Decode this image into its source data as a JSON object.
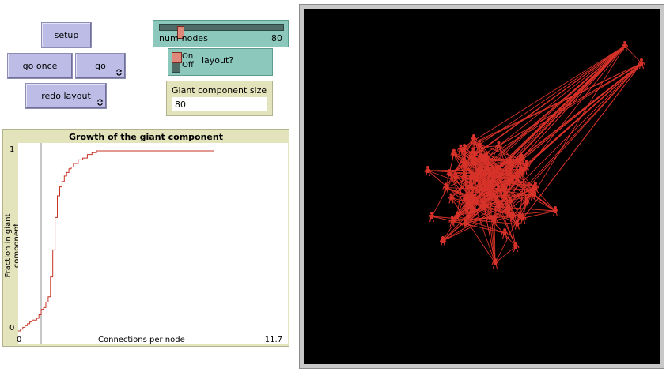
{
  "buttons": {
    "setup": "setup",
    "go_once": "go once",
    "go": "go",
    "redo_layout": "redo layout"
  },
  "slider": {
    "label": "num-nodes",
    "value": "80",
    "fraction": 0.15
  },
  "switch": {
    "on_label": "On",
    "off_label": "Off",
    "name": "layout?",
    "state": "on"
  },
  "monitor": {
    "label": "Giant component size",
    "value": "80"
  },
  "plot": {
    "title": "Growth of the giant component",
    "ylabel": "Fraction in giant component",
    "xlabel": "Connections per node",
    "y_min_label": "0",
    "y_max_label": "1",
    "x_min_label": "0",
    "x_max_label": "11.7"
  },
  "chart_data": {
    "type": "line",
    "title": "Growth of the giant component",
    "xlabel": "Connections per node",
    "ylabel": "Fraction in giant component",
    "xlim": [
      0,
      11.7
    ],
    "ylim": [
      0,
      1
    ],
    "series": [
      {
        "x": [
          0,
          0.1,
          0.2,
          0.3,
          0.4,
          0.5,
          0.6,
          0.7,
          0.8,
          0.9,
          1.0,
          1.1,
          1.2,
          1.3,
          1.4,
          1.5,
          1.6,
          1.7,
          1.8,
          1.9,
          2.0,
          2.1,
          2.2,
          2.3,
          2.4,
          2.6,
          2.8,
          3.0,
          3.2,
          3.4,
          3.6,
          4.0,
          4.5,
          5.0,
          5.5,
          6.0,
          6.5,
          7.0,
          7.5,
          8.0,
          8.5
        ],
        "y": [
          0.0,
          0.01,
          0.02,
          0.03,
          0.04,
          0.05,
          0.06,
          0.06,
          0.07,
          0.09,
          0.12,
          0.13,
          0.16,
          0.19,
          0.3,
          0.45,
          0.63,
          0.75,
          0.8,
          0.83,
          0.86,
          0.88,
          0.9,
          0.91,
          0.93,
          0.95,
          0.96,
          0.98,
          0.99,
          1.0,
          1.0,
          1.0,
          1.0,
          1.0,
          1.0,
          1.0,
          1.0,
          1.0,
          1.0,
          1.0,
          1.0
        ]
      }
    ]
  },
  "icons": {
    "forever": "forever-arrows-icon",
    "node": "person-icon"
  },
  "colors": {
    "link": "#d73229",
    "node": "#d73229",
    "pen": "#d73229"
  }
}
